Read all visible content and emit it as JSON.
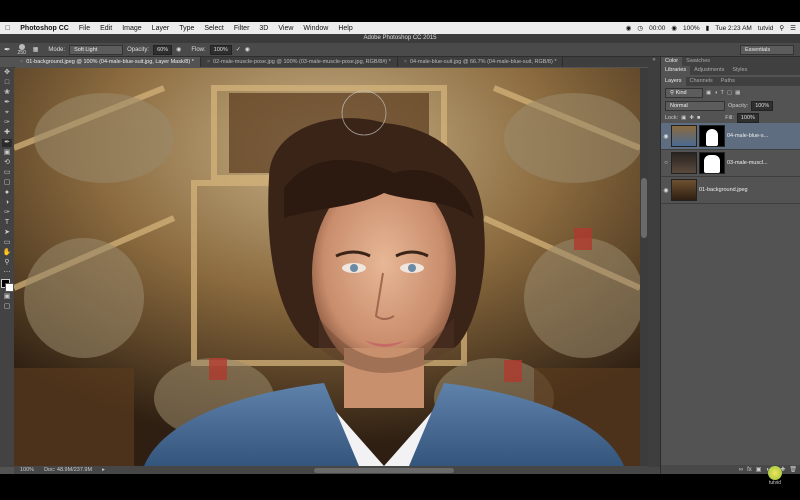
{
  "menubar": {
    "apple": "",
    "app": "Photoshop CC",
    "items": [
      "File",
      "Edit",
      "Image",
      "Layer",
      "Type",
      "Select",
      "Filter",
      "3D",
      "View",
      "Window",
      "Help"
    ],
    "status": {
      "clock": "00:00",
      "battery": "100%",
      "datetime": "Tue 2:23 AM",
      "user": "tutvid"
    }
  },
  "window_title": "Adobe Photoshop CC 2015",
  "options": {
    "brush_size": "250",
    "mode_label": "Mode:",
    "mode_value": "Soft Light",
    "opacity_label": "Opacity:",
    "opacity_value": "60%",
    "flow_label": "Flow:",
    "flow_value": "100%",
    "workspace": "Essentials"
  },
  "tabs": [
    {
      "label": "01-background.jpeg @ 100% (04-male-blue-suit.jpg, Layer Mask/8) *"
    },
    {
      "label": "02-male-muscle-pose.jpg @ 100% (03-male-muscle-pose.jpg, RGB/8#) *"
    },
    {
      "label": "04-male-blue-suit.jpg @ 66.7% (04-male-blue-suit, RGB/8) *"
    }
  ],
  "status": {
    "zoom": "100%",
    "doc": "Doc: 48.9M/237.9M"
  },
  "panels": {
    "color_tabs": [
      "Color",
      "Swatches"
    ],
    "lib_tabs": [
      "Libraries",
      "Adjustments",
      "Styles"
    ],
    "layer_tabs": [
      "Layers",
      "Channels",
      "Paths"
    ],
    "kind": "Kind",
    "blend_mode": "Normal",
    "opacity_label": "Opacity:",
    "opacity_value": "100%",
    "lock_label": "Lock:",
    "fill_label": "Fill:",
    "fill_value": "100%",
    "layers": [
      {
        "name": "04-male-blue-s...",
        "selected": true
      },
      {
        "name": "03-male-muscl...",
        "selected": false
      },
      {
        "name": "01-background.jpeg",
        "selected": false
      }
    ]
  },
  "watermark": "tutvid",
  "colors": {
    "selected_layer": "#5f6d80",
    "panel": "#535353",
    "dark": "#2f2f2f"
  }
}
